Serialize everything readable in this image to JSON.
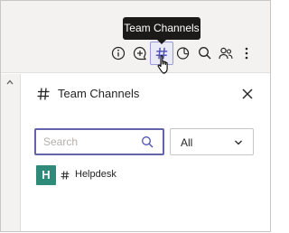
{
  "tooltip": {
    "text": "Team Channels"
  },
  "toolbar": {
    "icons": [
      "info-icon",
      "chat-add-icon",
      "hash-icon",
      "sticker-icon",
      "search-icon",
      "people-icon",
      "more-icon"
    ]
  },
  "panel": {
    "title": "Team Channels",
    "search": {
      "placeholder": "Search",
      "value": ""
    },
    "filter": {
      "selected": "All"
    },
    "channels": [
      {
        "team_initial": "H",
        "name": "Helpdesk",
        "avatar_color": "#2e8b7a"
      }
    ]
  },
  "colors": {
    "accent": "#6264a7",
    "tooltip_bg": "#1b1a19",
    "team_avatar": "#2e8b7a"
  }
}
